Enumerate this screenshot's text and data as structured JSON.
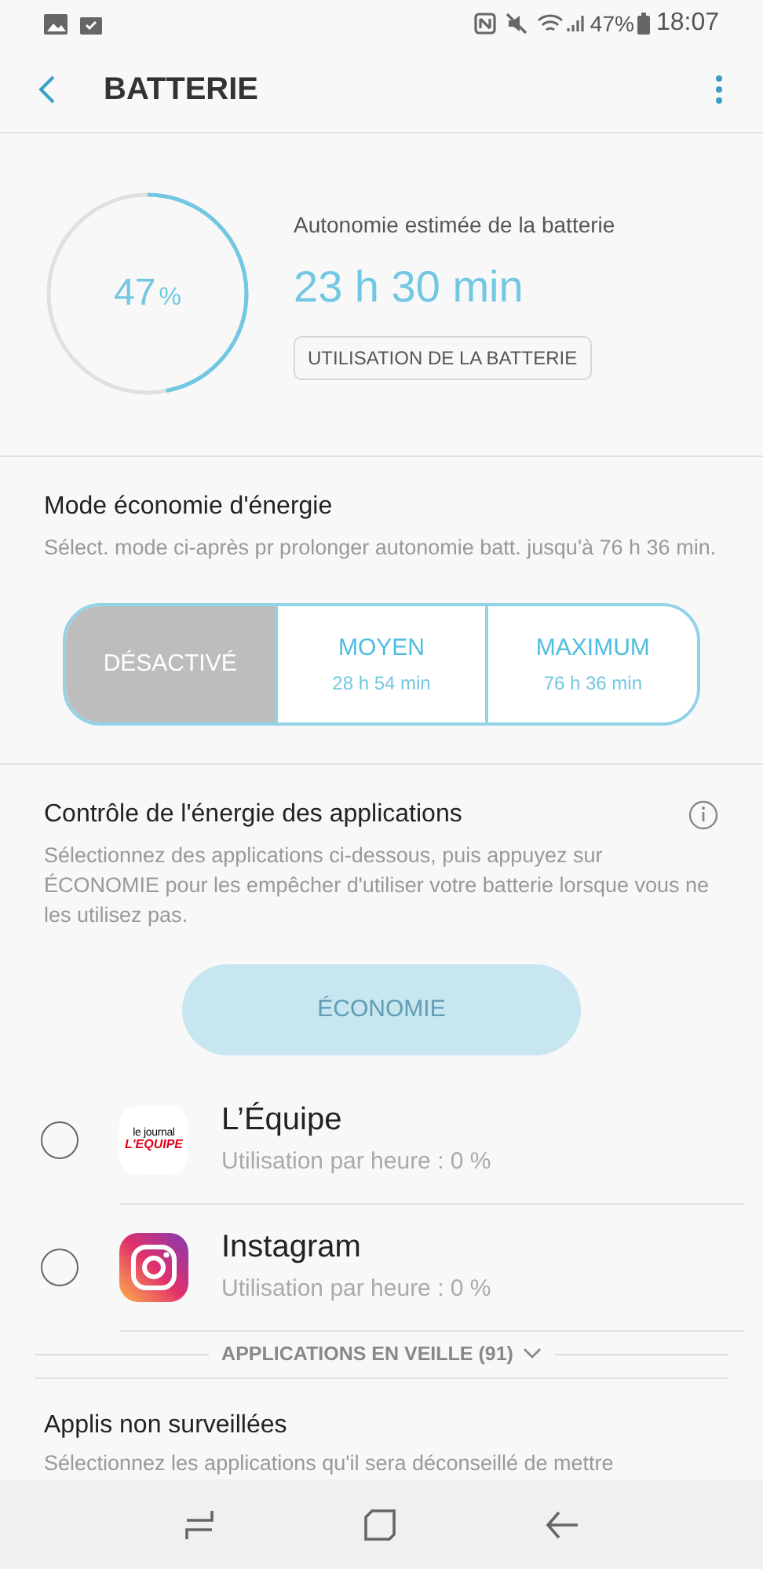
{
  "status_bar": {
    "battery": "47%",
    "time": "18:07"
  },
  "app_bar": {
    "title": "BATTERIE"
  },
  "battery": {
    "percent": "47",
    "percent_sign": "%",
    "caption": "Autonomie estimée de la batterie",
    "remaining": "23 h 30 min",
    "usage_button": "UTILISATION DE LA BATTERIE"
  },
  "power_saving": {
    "title": "Mode économie d'énergie",
    "description": "Sélect. mode ci-après pr prolonger autonomie batt. jusqu'à 76 h 36 min.",
    "modes": [
      {
        "label": "DÉSACTIVÉ",
        "selected": true
      },
      {
        "label": "MOYEN",
        "time": "28 h 54 min",
        "selected": false
      },
      {
        "label": "MAXIMUM",
        "time": "76 h 36 min",
        "selected": false
      }
    ]
  },
  "app_power": {
    "title": "Contrôle de l'énergie des applications",
    "description": "Sélectionnez des applications ci-dessous, puis appuyez sur ÉCONOMIE pour les empêcher d'utiliser votre batterie lorsque vous ne les utilisez pas.",
    "button": {
      "label": "ÉCONOMIE",
      "disabled": true
    },
    "apps": [
      {
        "kind": "journal",
        "name": "L’Équipe",
        "logo_lines": [
          "le journal",
          "L'EQUIPE"
        ],
        "usage": "Utilisation par heure : 0 %",
        "checked": false
      },
      {
        "kind": "camera",
        "name": "Instagram",
        "usage": "Utilisation par heure : 0 %",
        "checked": false
      }
    ],
    "sleeping": "APPLICATIONS EN VEILLE (91)"
  },
  "unmonitored": {
    "title": "Applis non surveillées",
    "description": "Sélectionnez les applications qu'il sera déconseillé de mettre"
  }
}
